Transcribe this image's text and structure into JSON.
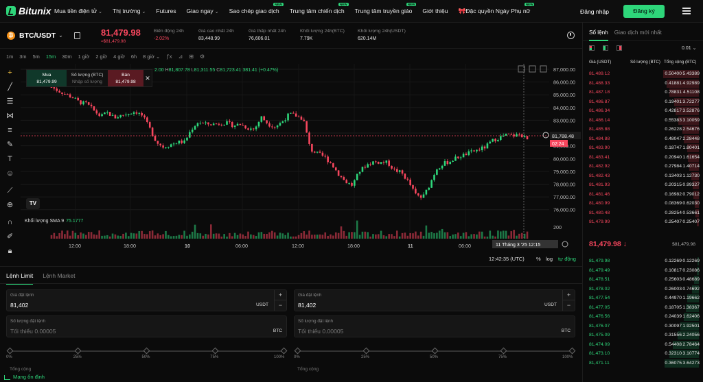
{
  "header": {
    "logo": "Bitunix",
    "nav": [
      {
        "label": "Mua tiền điện tử",
        "caret": true,
        "new": false
      },
      {
        "label": "Thị trường",
        "caret": true,
        "new": false
      },
      {
        "label": "Futures",
        "caret": false,
        "new": false
      },
      {
        "label": "Giao ngay",
        "caret": true,
        "new": false
      },
      {
        "label": "Sao chép giao dịch",
        "caret": false,
        "new": true
      },
      {
        "label": "Trung tâm chiến dịch",
        "caret": false,
        "new": true
      },
      {
        "label": "Trung tâm truyền giáo",
        "caret": false,
        "new": true
      },
      {
        "label": "Giới thiệu",
        "caret": false,
        "new": false
      },
      {
        "label": "🎀Đặc quyền Ngày Phụ nữ",
        "caret": false,
        "new": true
      }
    ],
    "new_badge": "NEW",
    "login": "Đăng nhập",
    "register": "Đăng ký"
  },
  "ticker": {
    "coin_symbol": "₿",
    "pair": "BTC/USDT",
    "price": "81,479.98",
    "price_sub": "≈$81,479.98",
    "stats": [
      {
        "label": "Biến động 24h",
        "value": "-2.02%",
        "color": "red"
      },
      {
        "label": "Giá cao nhất 24h",
        "value": "83,448.99",
        "color": "white"
      },
      {
        "label": "Giá thấp nhất 24h",
        "value": "76,606.01",
        "color": "white"
      },
      {
        "label": "Khối lượng 24h(BTC)",
        "value": "7.79K",
        "color": "white"
      },
      {
        "label": "Khối lượng 24h(USDT)",
        "value": "620.14M",
        "color": "white"
      }
    ]
  },
  "timeframes": [
    "1m",
    "3m",
    "5m",
    "15m",
    "30m",
    "1 giờ",
    "2 giờ",
    "4 giờ",
    "6h",
    "8 giờ ⌄"
  ],
  "active_timeframe": "15m",
  "quick_order": {
    "buy_label": "Mua",
    "buy_price": "81,479.99",
    "qty_label": "Số lượng (BTC)",
    "qty_placeholder": "Nhập số lượng",
    "sell_label": "Bán",
    "sell_price": "81,479.98"
  },
  "ohlc": {
    "o": "2.00",
    "h_label": "H",
    "h": "81,807.78",
    "l_label": "L",
    "l": "81,311.55",
    "c_label": "C",
    "c": "81,723.41",
    "chg": "381.41 (+0.47%)"
  },
  "volume_label": "Khối lượng SMA 9",
  "volume_value": "75.1777",
  "price_tag": "81,788.48",
  "countdown": "02:24",
  "crosshair_time": "11 Tháng 3 '25",
  "crosshair_clock": "12:15",
  "chart_footer": {
    "time": "12:42:35 (UTC)",
    "pct": "%",
    "log": "log",
    "auto": "tự động"
  },
  "chart_data": {
    "type": "candlestick",
    "y_ticks": [
      "87,000.00",
      "86,000.00",
      "85,000.00",
      "84,000.00",
      "83,000.00",
      "82,000.00",
      "81,000.00",
      "80,000.00",
      "79,000.00",
      "78,000.00",
      "77,000.00",
      "76,000.00"
    ],
    "ylim": [
      75500,
      87000
    ],
    "x_ticks": [
      "12:00",
      "18:00",
      "10",
      "06:00",
      "12:00",
      "18:00",
      "11",
      "06:00"
    ],
    "volume_tick": "200",
    "close_path": [
      85600,
      85300,
      85050,
      84800,
      84400,
      84300,
      83800,
      83300,
      83600,
      83200,
      83400,
      83550,
      83700,
      83350,
      82400,
      81300,
      80900,
      81100,
      81300,
      81300,
      82300,
      82900,
      82700,
      82700,
      82750,
      82800,
      82600,
      82700,
      82400,
      82300,
      83250,
      82700,
      82500,
      82900,
      83500,
      83350,
      83100,
      80700,
      80400,
      80150,
      79600,
      78800,
      78200,
      77900,
      79000,
      79500,
      79750,
      79700,
      79700,
      79100,
      78900,
      78200,
      77200,
      76900,
      77900,
      79200,
      79600,
      79800,
      80100,
      80300,
      80500,
      80700,
      80900,
      81400,
      81650,
      81850,
      81800,
      81900,
      81480
    ]
  },
  "order_form": {
    "tabs": [
      "Lệnh Limit",
      "Lệnh Market"
    ],
    "active_tab": "Lệnh Limit",
    "buy": {
      "price_label": "Giá đặt lệnh",
      "price": "81,402",
      "price_unit": "USDT",
      "qty_label": "Số lượng đặt lệnh",
      "qty_placeholder": "Tối thiểu 0.00005",
      "qty_unit": "BTC",
      "total_label": "Tổng cộng"
    },
    "sell": {
      "price_label": "Giá đặt lệnh",
      "price": "81,402",
      "price_unit": "USDT",
      "qty_label": "Số lượng đặt lệnh",
      "qty_placeholder": "Tối thiểu 0.00005",
      "qty_unit": "BTC",
      "total_label": "Tổng cộng"
    },
    "slider_marks": [
      "0%",
      "25%",
      "50%",
      "75%",
      "100%"
    ],
    "status": "Mạng ổn định"
  },
  "orderbook": {
    "tabs": [
      "Sổ lệnh",
      "Giao dịch mới nhất"
    ],
    "active_tab": "Sổ lệnh",
    "precision": "0.01 ⌄",
    "headers": [
      "Giá (USDT)",
      "Số lượng (BTC)",
      "Tổng cộng (BTC)"
    ],
    "asks": [
      {
        "p": "81,489.12",
        "a": "0.50400",
        "t": "5.43389",
        "d": 1.0
      },
      {
        "p": "81,488.33",
        "a": "0.41881",
        "t": "4.92989",
        "d": 0.91
      },
      {
        "p": "81,487.18",
        "a": "0.78831",
        "t": "4.51108",
        "d": 0.83
      },
      {
        "p": "81,486.87",
        "a": "0.19401",
        "t": "3.72277",
        "d": 0.69
      },
      {
        "p": "81,486.34",
        "a": "0.42817",
        "t": "3.52876",
        "d": 0.65
      },
      {
        "p": "81,486.14",
        "a": "0.55383",
        "t": "3.10059",
        "d": 0.57
      },
      {
        "p": "81,485.88",
        "a": "0.26228",
        "t": "2.54676",
        "d": 0.47
      },
      {
        "p": "81,484.88",
        "a": "0.48047",
        "t": "2.28448",
        "d": 0.42
      },
      {
        "p": "81,483.90",
        "a": "0.18747",
        "t": "1.80401",
        "d": 0.33
      },
      {
        "p": "81,483.41",
        "a": "0.20940",
        "t": "1.61654",
        "d": 0.3
      },
      {
        "p": "81,482.92",
        "a": "0.27984",
        "t": "1.40714",
        "d": 0.26
      },
      {
        "p": "81,482.43",
        "a": "0.13403",
        "t": "1.12730",
        "d": 0.21
      },
      {
        "p": "81,481.93",
        "a": "0.20315",
        "t": "0.99327",
        "d": 0.18
      },
      {
        "p": "81,481.46",
        "a": "0.16982",
        "t": "0.79012",
        "d": 0.15
      },
      {
        "p": "81,480.99",
        "a": "0.08369",
        "t": "0.62030",
        "d": 0.11
      },
      {
        "p": "81,480.48",
        "a": "0.28254",
        "t": "0.53661",
        "d": 0.1
      },
      {
        "p": "81,479.99",
        "a": "0.25407",
        "t": "0.25407",
        "d": 0.05
      }
    ],
    "mid_price": "81,479.98 ↓",
    "mid_usd": "$81,479.98",
    "bids": [
      {
        "p": "81,479.98",
        "a": "0.12269",
        "t": "0.12269",
        "d": 0.03
      },
      {
        "p": "81,479.49",
        "a": "0.10817",
        "t": "0.23086",
        "d": 0.06
      },
      {
        "p": "81,478.51",
        "a": "0.25603",
        "t": "0.48689",
        "d": 0.13
      },
      {
        "p": "81,478.02",
        "a": "0.26003",
        "t": "0.74692",
        "d": 0.2
      },
      {
        "p": "81,477.54",
        "a": "0.44970",
        "t": "1.19662",
        "d": 0.32
      },
      {
        "p": "81,477.05",
        "a": "0.18705",
        "t": "1.38367",
        "d": 0.37
      },
      {
        "p": "81,476.56",
        "a": "0.24039",
        "t": "1.62406",
        "d": 0.43
      },
      {
        "p": "81,476.07",
        "a": "0.30097",
        "t": "1.92501",
        "d": 0.51
      },
      {
        "p": "81,475.09",
        "a": "0.31556",
        "t": "2.24056",
        "d": 0.6
      },
      {
        "p": "81,474.09",
        "a": "0.54408",
        "t": "2.78464",
        "d": 0.74
      },
      {
        "p": "81,473.10",
        "a": "0.32310",
        "t": "3.10774",
        "d": 0.83
      },
      {
        "p": "81,471.11",
        "a": "0.36075",
        "t": "3.64273",
        "d": 0.97
      }
    ]
  },
  "colors": {
    "up": "#2ed67a",
    "down": "#f6465d",
    "accent": "#2ed67a",
    "bg": "#0b0b0b"
  }
}
